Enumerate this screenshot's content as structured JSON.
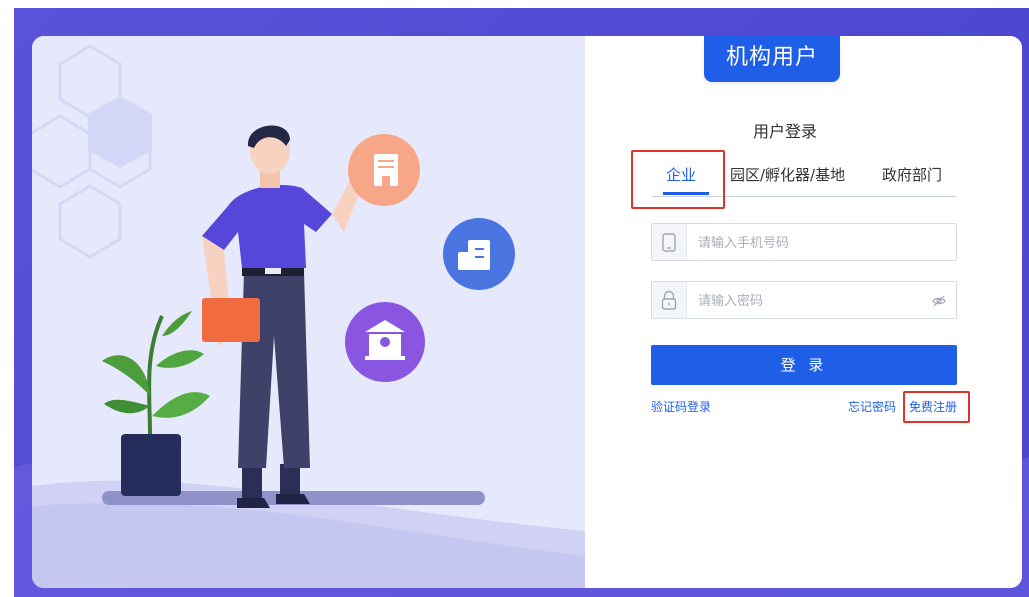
{
  "badge": {
    "label": "机构用户"
  },
  "login": {
    "title": "用户登录",
    "tabs": [
      {
        "label": "企业",
        "active": true
      },
      {
        "label": "园区/孵化器/基地",
        "active": false
      },
      {
        "label": "政府部门",
        "active": false
      }
    ],
    "phone": {
      "placeholder": "请输入手机号码",
      "icon": "phone-icon"
    },
    "password": {
      "placeholder": "请输入密码",
      "icon": "lock-icon",
      "toggle_icon": "eye-off-icon"
    },
    "submit_label": "登 录",
    "links": {
      "code_login": "验证码登录",
      "forgot": "忘记密码",
      "register": "免费注册"
    }
  },
  "colors": {
    "primary": "#1f5fe8",
    "background": "#5a52d8",
    "illustration_bg": "#e6e8fb",
    "highlight": "#e0322b"
  },
  "illustration": {
    "icons": [
      "building-icon",
      "office-icon",
      "bank-icon",
      "plant-icon",
      "man-figure"
    ]
  }
}
